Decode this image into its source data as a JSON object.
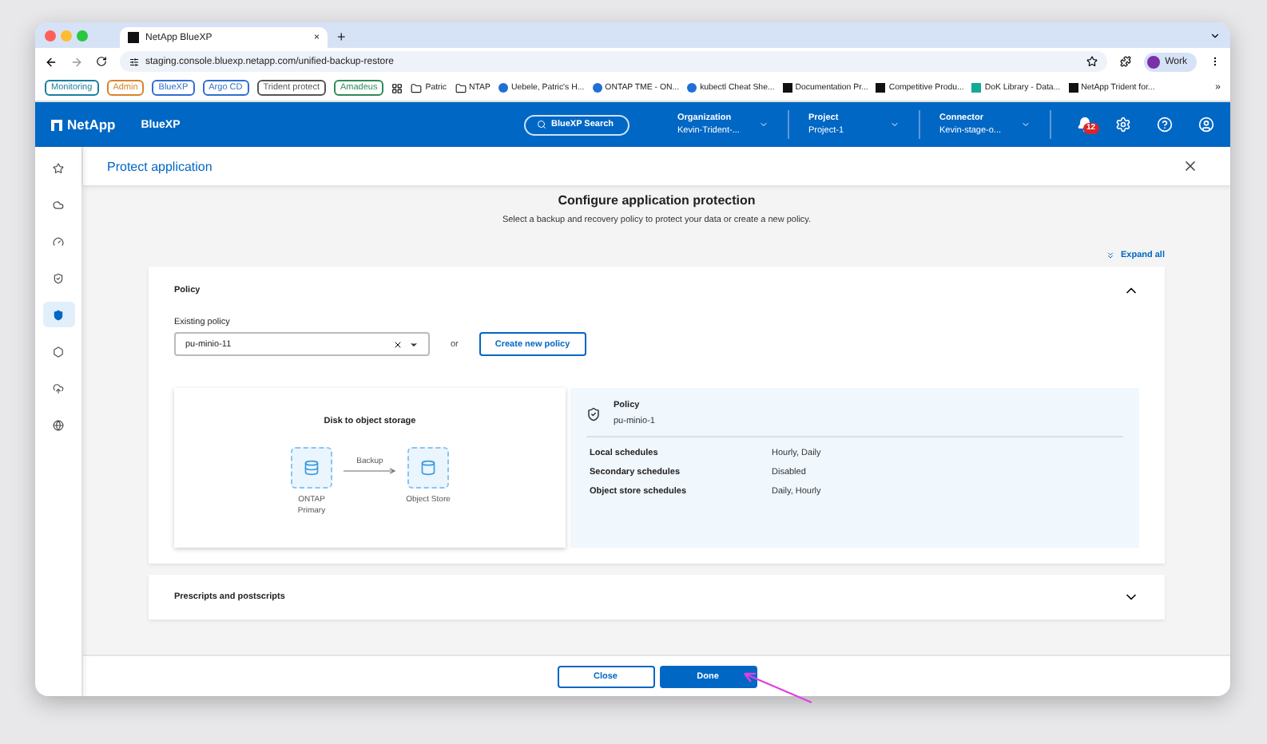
{
  "browser": {
    "tab_title": "NetApp BlueXP",
    "tab_close": "×",
    "new_tab": "+",
    "url": "staging.console.bluexp.netapp.com/unified-backup-restore",
    "profile": "Work",
    "bookmarks": [
      {
        "kind": "pill",
        "label": "Monitoring",
        "color": "#1a7fa0"
      },
      {
        "kind": "pill",
        "label": "Admin",
        "color": "#d9822b"
      },
      {
        "kind": "pill",
        "label": "BlueXP",
        "color": "#2f6fd0"
      },
      {
        "kind": "pill",
        "label": "Argo CD",
        "color": "#2f6fd0"
      },
      {
        "kind": "pill",
        "label": "Trident protect",
        "color": "#555555"
      },
      {
        "kind": "pill",
        "label": "Amadeus",
        "color": "#2e8b57"
      },
      {
        "kind": "apps"
      },
      {
        "kind": "folder",
        "label": "Patric"
      },
      {
        "kind": "folder",
        "label": "NTAP"
      },
      {
        "kind": "link",
        "label": "Uebele, Patric's H..."
      },
      {
        "kind": "link",
        "label": "ONTAP TME - ON..."
      },
      {
        "kind": "link",
        "label": "kubectl Cheat She..."
      },
      {
        "kind": "link",
        "label": "Documentation Pr..."
      },
      {
        "kind": "link",
        "label": "Competitive Produ..."
      },
      {
        "kind": "link",
        "label": "DoK Library - Data..."
      },
      {
        "kind": "link",
        "label": "NetApp Trident for..."
      }
    ],
    "more": "»"
  },
  "header": {
    "brand": "NetApp",
    "product": "BlueXP",
    "search": "BlueXP Search",
    "selectors": [
      {
        "label": "Organization",
        "value": "Kevin-Trident-..."
      },
      {
        "label": "Project",
        "value": "Project-1"
      },
      {
        "label": "Connector",
        "value": "Kevin-stage-o..."
      }
    ],
    "notifications": "12"
  },
  "sidebar": {
    "items": [
      {
        "selected": false
      },
      {
        "selected": false
      },
      {
        "selected": false
      },
      {
        "selected": false
      },
      {
        "selected": true
      },
      {
        "selected": false
      },
      {
        "selected": false
      },
      {
        "selected": false
      }
    ]
  },
  "page": {
    "title": "Protect application",
    "heading": "Configure application protection",
    "subtitle": "Select a backup and recovery policy to protect your data or create a new policy.",
    "expand_all": "Expand all"
  },
  "policy_section": {
    "title": "Policy",
    "expanded": true,
    "field_label": "Existing policy",
    "value": "pu-minio-11",
    "or": "or",
    "create_button": "Create new policy",
    "diagram": {
      "title": "Disk to object storage",
      "source": [
        "ONTAP",
        "Primary"
      ],
      "connection": "Backup",
      "target": [
        "Object Store"
      ]
    },
    "details": {
      "title": "Policy",
      "name": "pu-minio-1",
      "rows": [
        {
          "label": "Local schedules",
          "value": "Hourly, Daily"
        },
        {
          "label": "Secondary schedules",
          "value": "Disabled"
        },
        {
          "label": "Object store schedules",
          "value": "Daily, Hourly"
        }
      ]
    }
  },
  "scripts_section": {
    "title": "Prescripts and postscripts",
    "expanded": false
  },
  "footer": {
    "buttons": [
      {
        "label": "Close",
        "kind": "secondary"
      },
      {
        "label": "Done",
        "kind": "primary"
      }
    ]
  }
}
